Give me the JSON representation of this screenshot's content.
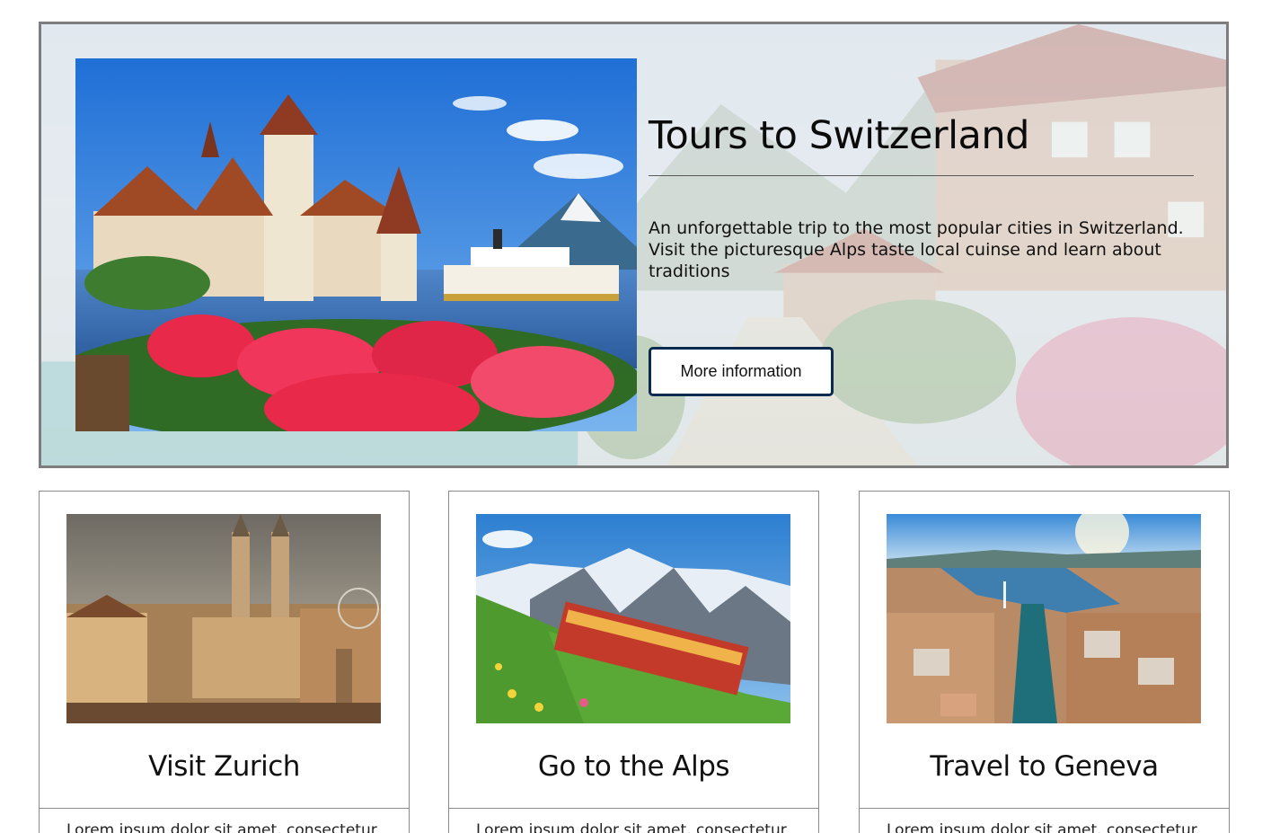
{
  "hero": {
    "title": "Tours to Switzerland",
    "description": "An unforgettable trip to the most popular cities in Switzerland. Visit the picturesque Alps taste local cuinse and learn about traditions",
    "button_label": "More information",
    "photo_icon": "castle-lake-photo",
    "background_icon": "village-street-photo"
  },
  "cards": [
    {
      "title": "Visit Zurich",
      "text": "Lorem ipsum dolor sit amet, consectetur",
      "photo_icon": "zurich-cathedral-photo"
    },
    {
      "title": "Go to the Alps",
      "text": "Lorem ipsum dolor sit amet, consectetur",
      "photo_icon": "alps-train-photo"
    },
    {
      "title": "Travel to Geneva",
      "text": "Lorem ipsum dolor sit amet, consectetur",
      "photo_icon": "geneva-aerial-photo"
    }
  ],
  "colors": {
    "button_border": "#0b2a4f",
    "hero_border": "#7d7d7d",
    "card_border": "#8a8a8a"
  }
}
